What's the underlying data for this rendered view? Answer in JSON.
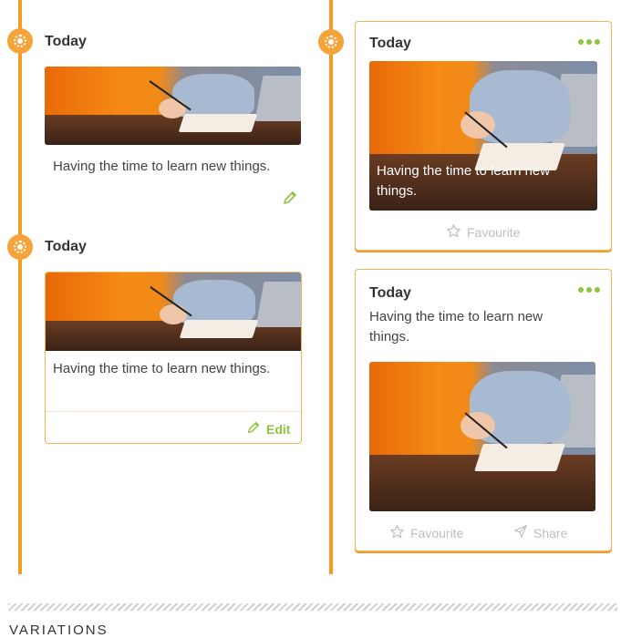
{
  "colors": {
    "accent": "#f39c26",
    "green": "#8cc63f",
    "muted": "#bfbfbf"
  },
  "left_column": {
    "entry1": {
      "title": "Today",
      "text": "Having the time to learn new things.",
      "edit_icon": "pencil-icon"
    },
    "entry2": {
      "title": "Today",
      "text": "Having the time to learn new things.",
      "edit_label": "Edit"
    }
  },
  "right_column": {
    "card1": {
      "title": "Today",
      "caption": "Having the time to learn new things.",
      "favourite_label": "Favourite"
    },
    "card2": {
      "title": "Today",
      "text": "Having the time to learn new things.",
      "favourite_label": "Favourite",
      "share_label": "Share"
    }
  },
  "footer": {
    "section_label": "VARIATIONS"
  }
}
